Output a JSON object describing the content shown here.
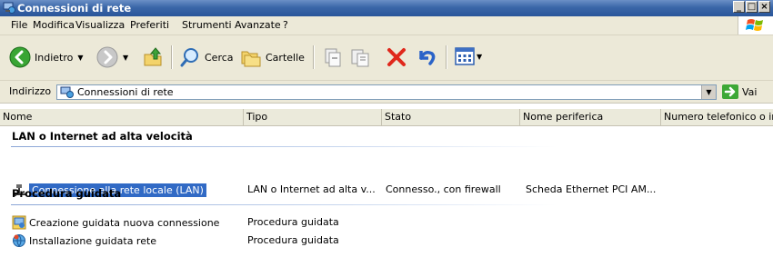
{
  "window": {
    "title": "Connessioni di rete",
    "buttons": [
      "_",
      "□",
      "×"
    ]
  },
  "menu": [
    "File",
    "Modifica",
    "Visualizza",
    "Preferiti",
    "Strumenti",
    "Avanzate",
    "?"
  ],
  "toolbar": {
    "back": "Indietro",
    "search": "Cerca",
    "folders": "Cartelle"
  },
  "address": {
    "label": "Indirizzo",
    "value": "Connessioni di rete",
    "go": "Vai"
  },
  "columns": [
    "Nome",
    "Tipo",
    "Stato",
    "Nome periferica",
    "Numero telefonico o in"
  ],
  "groups": [
    {
      "title": "LAN o Internet ad alta velocità",
      "items": [
        {
          "name": "Connessione alla rete locale (LAN)",
          "type": "LAN o Internet ad alta v...",
          "status": "Connesso., con firewall",
          "device": "Scheda Ethernet PCI AM...",
          "selected": true
        }
      ]
    },
    {
      "title": "Procedura guidata",
      "items": [
        {
          "name": "Creazione guidata nuova connessione",
          "type": "Procedura guidata"
        },
        {
          "name": "Installazione guidata rete",
          "type": "Procedura guidata"
        }
      ]
    }
  ],
  "colors": {
    "title_bar": "#2a559a",
    "selection": "#316ac5",
    "chrome": "#ece9d8"
  }
}
